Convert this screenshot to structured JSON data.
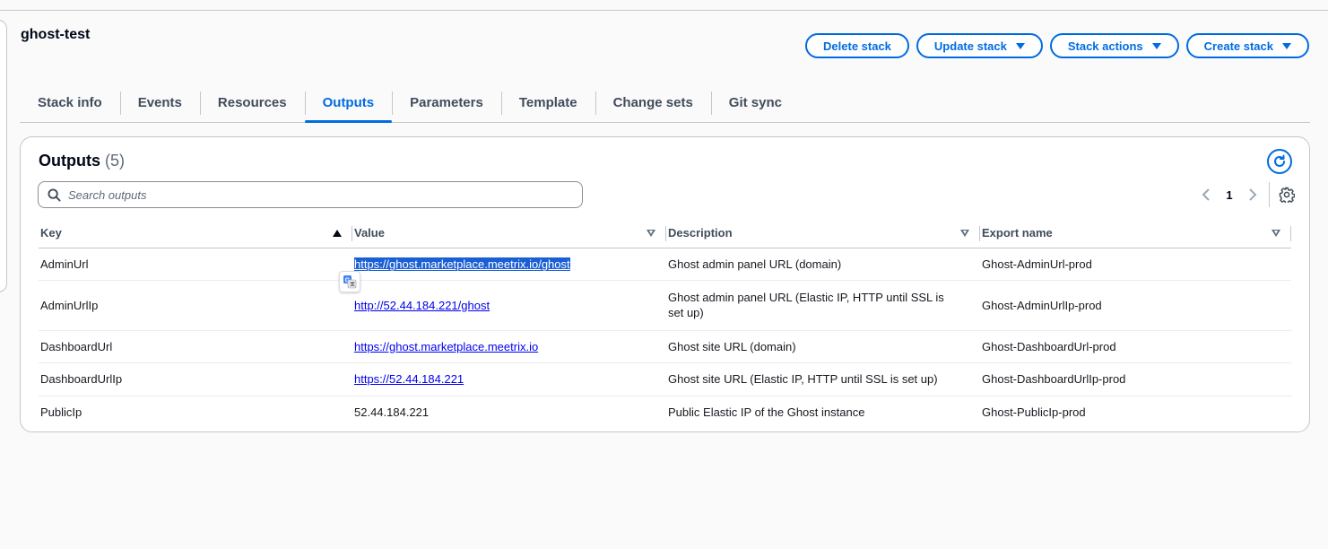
{
  "stack": {
    "name": "ghost-test"
  },
  "actions": {
    "delete": "Delete stack",
    "update": "Update stack",
    "stack_actions": "Stack actions",
    "create": "Create stack"
  },
  "tabs": [
    {
      "label": "Stack info"
    },
    {
      "label": "Events"
    },
    {
      "label": "Resources"
    },
    {
      "label": "Outputs",
      "active": true
    },
    {
      "label": "Parameters"
    },
    {
      "label": "Template"
    },
    {
      "label": "Change sets"
    },
    {
      "label": "Git sync"
    }
  ],
  "outputs": {
    "title": "Outputs",
    "count": "(5)",
    "search_placeholder": "Search outputs",
    "page": "1",
    "columns": {
      "key": "Key",
      "value": "Value",
      "description": "Description",
      "export": "Export name"
    },
    "rows": [
      {
        "key": "AdminUrl",
        "value": "https://ghost.marketplace.meetrix.io/ghost",
        "value_is_link": true,
        "selected": true,
        "description": "Ghost admin panel URL (domain)",
        "export": "Ghost-AdminUrl-prod"
      },
      {
        "key": "AdminUrlIp",
        "value": "http://52.44.184.221/ghost",
        "value_is_link": true,
        "description": "Ghost admin panel URL (Elastic IP, HTTP until SSL is set up)",
        "export": "Ghost-AdminUrlIp-prod"
      },
      {
        "key": "DashboardUrl",
        "value": "https://ghost.marketplace.meetrix.io",
        "value_is_link": true,
        "description": "Ghost site URL (domain)",
        "export": "Ghost-DashboardUrl-prod"
      },
      {
        "key": "DashboardUrlIp",
        "value": "https://52.44.184.221",
        "value_is_link": true,
        "description": "Ghost site URL (Elastic IP, HTTP until SSL is set up)",
        "export": "Ghost-DashboardUrlIp-prod"
      },
      {
        "key": "PublicIp",
        "value": "52.44.184.221",
        "value_is_link": false,
        "description": "Public Elastic IP of the Ghost instance",
        "export": "Ghost-PublicIp-prod"
      }
    ]
  },
  "colors": {
    "accent": "#006ce0",
    "link": "#0000ee",
    "selection": "#1a5fd4",
    "border": "#c6c6cd"
  },
  "icons": [
    "caret-down-icon",
    "refresh-icon",
    "search-icon",
    "chevron-left-icon",
    "chevron-right-icon",
    "gear-icon",
    "sort-ascending-icon",
    "sort-descending-icon",
    "translate-icon"
  ]
}
